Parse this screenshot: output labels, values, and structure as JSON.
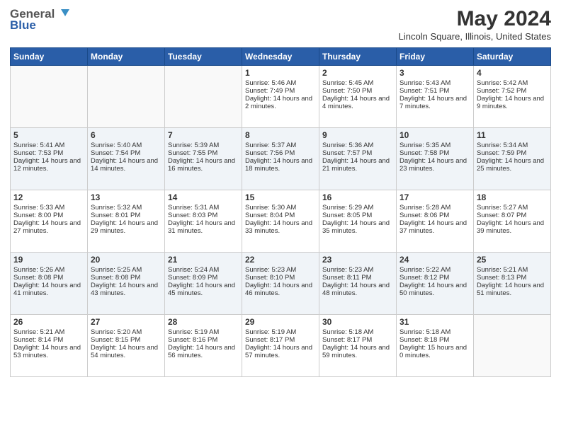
{
  "header": {
    "logo_general": "General",
    "logo_blue": "Blue",
    "month_title": "May 2024",
    "location": "Lincoln Square, Illinois, United States"
  },
  "days_of_week": [
    "Sunday",
    "Monday",
    "Tuesday",
    "Wednesday",
    "Thursday",
    "Friday",
    "Saturday"
  ],
  "weeks": [
    [
      {
        "day": "",
        "info": ""
      },
      {
        "day": "",
        "info": ""
      },
      {
        "day": "",
        "info": ""
      },
      {
        "day": "1",
        "sunrise": "Sunrise: 5:46 AM",
        "sunset": "Sunset: 7:49 PM",
        "daylight": "Daylight: 14 hours and 2 minutes."
      },
      {
        "day": "2",
        "sunrise": "Sunrise: 5:45 AM",
        "sunset": "Sunset: 7:50 PM",
        "daylight": "Daylight: 14 hours and 4 minutes."
      },
      {
        "day": "3",
        "sunrise": "Sunrise: 5:43 AM",
        "sunset": "Sunset: 7:51 PM",
        "daylight": "Daylight: 14 hours and 7 minutes."
      },
      {
        "day": "4",
        "sunrise": "Sunrise: 5:42 AM",
        "sunset": "Sunset: 7:52 PM",
        "daylight": "Daylight: 14 hours and 9 minutes."
      }
    ],
    [
      {
        "day": "5",
        "sunrise": "Sunrise: 5:41 AM",
        "sunset": "Sunset: 7:53 PM",
        "daylight": "Daylight: 14 hours and 12 minutes."
      },
      {
        "day": "6",
        "sunrise": "Sunrise: 5:40 AM",
        "sunset": "Sunset: 7:54 PM",
        "daylight": "Daylight: 14 hours and 14 minutes."
      },
      {
        "day": "7",
        "sunrise": "Sunrise: 5:39 AM",
        "sunset": "Sunset: 7:55 PM",
        "daylight": "Daylight: 14 hours and 16 minutes."
      },
      {
        "day": "8",
        "sunrise": "Sunrise: 5:37 AM",
        "sunset": "Sunset: 7:56 PM",
        "daylight": "Daylight: 14 hours and 18 minutes."
      },
      {
        "day": "9",
        "sunrise": "Sunrise: 5:36 AM",
        "sunset": "Sunset: 7:57 PM",
        "daylight": "Daylight: 14 hours and 21 minutes."
      },
      {
        "day": "10",
        "sunrise": "Sunrise: 5:35 AM",
        "sunset": "Sunset: 7:58 PM",
        "daylight": "Daylight: 14 hours and 23 minutes."
      },
      {
        "day": "11",
        "sunrise": "Sunrise: 5:34 AM",
        "sunset": "Sunset: 7:59 PM",
        "daylight": "Daylight: 14 hours and 25 minutes."
      }
    ],
    [
      {
        "day": "12",
        "sunrise": "Sunrise: 5:33 AM",
        "sunset": "Sunset: 8:00 PM",
        "daylight": "Daylight: 14 hours and 27 minutes."
      },
      {
        "day": "13",
        "sunrise": "Sunrise: 5:32 AM",
        "sunset": "Sunset: 8:01 PM",
        "daylight": "Daylight: 14 hours and 29 minutes."
      },
      {
        "day": "14",
        "sunrise": "Sunrise: 5:31 AM",
        "sunset": "Sunset: 8:03 PM",
        "daylight": "Daylight: 14 hours and 31 minutes."
      },
      {
        "day": "15",
        "sunrise": "Sunrise: 5:30 AM",
        "sunset": "Sunset: 8:04 PM",
        "daylight": "Daylight: 14 hours and 33 minutes."
      },
      {
        "day": "16",
        "sunrise": "Sunrise: 5:29 AM",
        "sunset": "Sunset: 8:05 PM",
        "daylight": "Daylight: 14 hours and 35 minutes."
      },
      {
        "day": "17",
        "sunrise": "Sunrise: 5:28 AM",
        "sunset": "Sunset: 8:06 PM",
        "daylight": "Daylight: 14 hours and 37 minutes."
      },
      {
        "day": "18",
        "sunrise": "Sunrise: 5:27 AM",
        "sunset": "Sunset: 8:07 PM",
        "daylight": "Daylight: 14 hours and 39 minutes."
      }
    ],
    [
      {
        "day": "19",
        "sunrise": "Sunrise: 5:26 AM",
        "sunset": "Sunset: 8:08 PM",
        "daylight": "Daylight: 14 hours and 41 minutes."
      },
      {
        "day": "20",
        "sunrise": "Sunrise: 5:25 AM",
        "sunset": "Sunset: 8:08 PM",
        "daylight": "Daylight: 14 hours and 43 minutes."
      },
      {
        "day": "21",
        "sunrise": "Sunrise: 5:24 AM",
        "sunset": "Sunset: 8:09 PM",
        "daylight": "Daylight: 14 hours and 45 minutes."
      },
      {
        "day": "22",
        "sunrise": "Sunrise: 5:23 AM",
        "sunset": "Sunset: 8:10 PM",
        "daylight": "Daylight: 14 hours and 46 minutes."
      },
      {
        "day": "23",
        "sunrise": "Sunrise: 5:23 AM",
        "sunset": "Sunset: 8:11 PM",
        "daylight": "Daylight: 14 hours and 48 minutes."
      },
      {
        "day": "24",
        "sunrise": "Sunrise: 5:22 AM",
        "sunset": "Sunset: 8:12 PM",
        "daylight": "Daylight: 14 hours and 50 minutes."
      },
      {
        "day": "25",
        "sunrise": "Sunrise: 5:21 AM",
        "sunset": "Sunset: 8:13 PM",
        "daylight": "Daylight: 14 hours and 51 minutes."
      }
    ],
    [
      {
        "day": "26",
        "sunrise": "Sunrise: 5:21 AM",
        "sunset": "Sunset: 8:14 PM",
        "daylight": "Daylight: 14 hours and 53 minutes."
      },
      {
        "day": "27",
        "sunrise": "Sunrise: 5:20 AM",
        "sunset": "Sunset: 8:15 PM",
        "daylight": "Daylight: 14 hours and 54 minutes."
      },
      {
        "day": "28",
        "sunrise": "Sunrise: 5:19 AM",
        "sunset": "Sunset: 8:16 PM",
        "daylight": "Daylight: 14 hours and 56 minutes."
      },
      {
        "day": "29",
        "sunrise": "Sunrise: 5:19 AM",
        "sunset": "Sunset: 8:17 PM",
        "daylight": "Daylight: 14 hours and 57 minutes."
      },
      {
        "day": "30",
        "sunrise": "Sunrise: 5:18 AM",
        "sunset": "Sunset: 8:17 PM",
        "daylight": "Daylight: 14 hours and 59 minutes."
      },
      {
        "day": "31",
        "sunrise": "Sunrise: 5:18 AM",
        "sunset": "Sunset: 8:18 PM",
        "daylight": "Daylight: 15 hours and 0 minutes."
      },
      {
        "day": "",
        "info": ""
      }
    ]
  ]
}
